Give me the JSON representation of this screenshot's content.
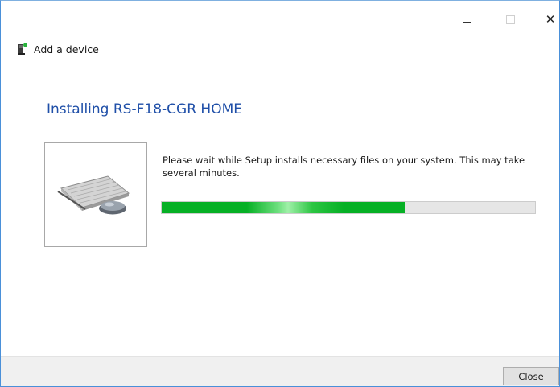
{
  "window": {
    "title_bar_buttons": {
      "minimize_icon": "minimize-icon",
      "maximize_icon": "maximize-icon",
      "close_icon": "close-icon",
      "close_glyph": "✕"
    }
  },
  "header": {
    "icon": "device-setup-icon",
    "title": "Add a device"
  },
  "main": {
    "heading": "Installing RS-F18-CGR HOME",
    "device_image": "keyboard-mouse-device-image",
    "message": "Please wait while Setup installs necessary files on your system. This may take several minutes.",
    "progress_percent": 65
  },
  "footer": {
    "close_label": "Close"
  },
  "colors": {
    "heading": "#1f4fa8",
    "progress_fill": "#06b025",
    "window_border": "#4a90d9",
    "footer_bg": "#f0f0f0"
  }
}
